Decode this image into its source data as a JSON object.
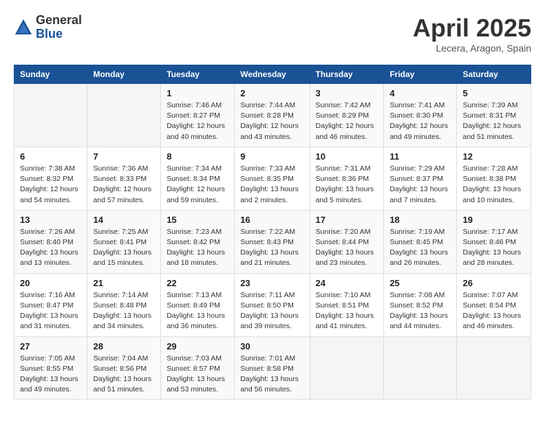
{
  "logo": {
    "general": "General",
    "blue": "Blue"
  },
  "title": "April 2025",
  "location": "Lecera, Aragon, Spain",
  "weekdays": [
    "Sunday",
    "Monday",
    "Tuesday",
    "Wednesday",
    "Thursday",
    "Friday",
    "Saturday"
  ],
  "weeks": [
    [
      {
        "day": "",
        "info": ""
      },
      {
        "day": "",
        "info": ""
      },
      {
        "day": "1",
        "info": "Sunrise: 7:46 AM\nSunset: 8:27 PM\nDaylight: 12 hours and 40 minutes."
      },
      {
        "day": "2",
        "info": "Sunrise: 7:44 AM\nSunset: 8:28 PM\nDaylight: 12 hours and 43 minutes."
      },
      {
        "day": "3",
        "info": "Sunrise: 7:42 AM\nSunset: 8:29 PM\nDaylight: 12 hours and 46 minutes."
      },
      {
        "day": "4",
        "info": "Sunrise: 7:41 AM\nSunset: 8:30 PM\nDaylight: 12 hours and 49 minutes."
      },
      {
        "day": "5",
        "info": "Sunrise: 7:39 AM\nSunset: 8:31 PM\nDaylight: 12 hours and 51 minutes."
      }
    ],
    [
      {
        "day": "6",
        "info": "Sunrise: 7:38 AM\nSunset: 8:32 PM\nDaylight: 12 hours and 54 minutes."
      },
      {
        "day": "7",
        "info": "Sunrise: 7:36 AM\nSunset: 8:33 PM\nDaylight: 12 hours and 57 minutes."
      },
      {
        "day": "8",
        "info": "Sunrise: 7:34 AM\nSunset: 8:34 PM\nDaylight: 12 hours and 59 minutes."
      },
      {
        "day": "9",
        "info": "Sunrise: 7:33 AM\nSunset: 8:35 PM\nDaylight: 13 hours and 2 minutes."
      },
      {
        "day": "10",
        "info": "Sunrise: 7:31 AM\nSunset: 8:36 PM\nDaylight: 13 hours and 5 minutes."
      },
      {
        "day": "11",
        "info": "Sunrise: 7:29 AM\nSunset: 8:37 PM\nDaylight: 13 hours and 7 minutes."
      },
      {
        "day": "12",
        "info": "Sunrise: 7:28 AM\nSunset: 8:38 PM\nDaylight: 13 hours and 10 minutes."
      }
    ],
    [
      {
        "day": "13",
        "info": "Sunrise: 7:26 AM\nSunset: 8:40 PM\nDaylight: 13 hours and 13 minutes."
      },
      {
        "day": "14",
        "info": "Sunrise: 7:25 AM\nSunset: 8:41 PM\nDaylight: 13 hours and 15 minutes."
      },
      {
        "day": "15",
        "info": "Sunrise: 7:23 AM\nSunset: 8:42 PM\nDaylight: 13 hours and 18 minutes."
      },
      {
        "day": "16",
        "info": "Sunrise: 7:22 AM\nSunset: 8:43 PM\nDaylight: 13 hours and 21 minutes."
      },
      {
        "day": "17",
        "info": "Sunrise: 7:20 AM\nSunset: 8:44 PM\nDaylight: 13 hours and 23 minutes."
      },
      {
        "day": "18",
        "info": "Sunrise: 7:19 AM\nSunset: 8:45 PM\nDaylight: 13 hours and 26 minutes."
      },
      {
        "day": "19",
        "info": "Sunrise: 7:17 AM\nSunset: 8:46 PM\nDaylight: 13 hours and 28 minutes."
      }
    ],
    [
      {
        "day": "20",
        "info": "Sunrise: 7:16 AM\nSunset: 8:47 PM\nDaylight: 13 hours and 31 minutes."
      },
      {
        "day": "21",
        "info": "Sunrise: 7:14 AM\nSunset: 8:48 PM\nDaylight: 13 hours and 34 minutes."
      },
      {
        "day": "22",
        "info": "Sunrise: 7:13 AM\nSunset: 8:49 PM\nDaylight: 13 hours and 36 minutes."
      },
      {
        "day": "23",
        "info": "Sunrise: 7:11 AM\nSunset: 8:50 PM\nDaylight: 13 hours and 39 minutes."
      },
      {
        "day": "24",
        "info": "Sunrise: 7:10 AM\nSunset: 8:51 PM\nDaylight: 13 hours and 41 minutes."
      },
      {
        "day": "25",
        "info": "Sunrise: 7:08 AM\nSunset: 8:52 PM\nDaylight: 13 hours and 44 minutes."
      },
      {
        "day": "26",
        "info": "Sunrise: 7:07 AM\nSunset: 8:54 PM\nDaylight: 13 hours and 46 minutes."
      }
    ],
    [
      {
        "day": "27",
        "info": "Sunrise: 7:05 AM\nSunset: 8:55 PM\nDaylight: 13 hours and 49 minutes."
      },
      {
        "day": "28",
        "info": "Sunrise: 7:04 AM\nSunset: 8:56 PM\nDaylight: 13 hours and 51 minutes."
      },
      {
        "day": "29",
        "info": "Sunrise: 7:03 AM\nSunset: 8:57 PM\nDaylight: 13 hours and 53 minutes."
      },
      {
        "day": "30",
        "info": "Sunrise: 7:01 AM\nSunset: 8:58 PM\nDaylight: 13 hours and 56 minutes."
      },
      {
        "day": "",
        "info": ""
      },
      {
        "day": "",
        "info": ""
      },
      {
        "day": "",
        "info": ""
      }
    ]
  ]
}
